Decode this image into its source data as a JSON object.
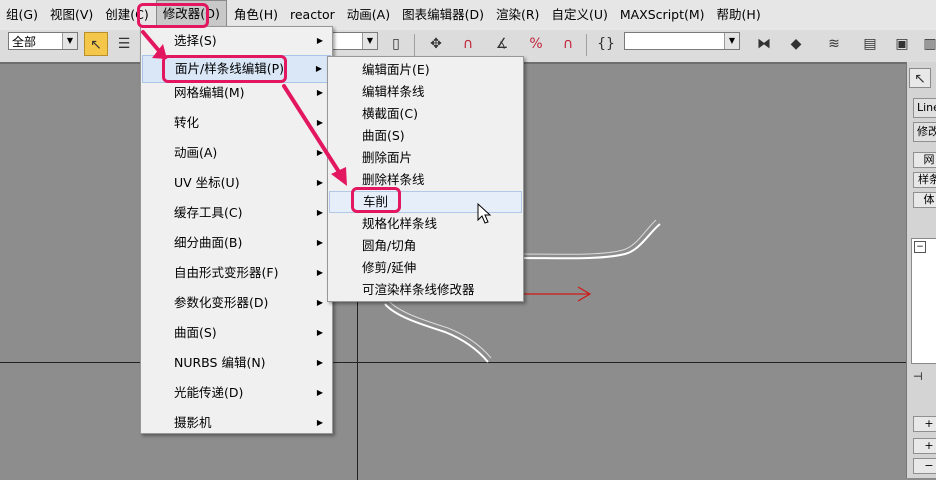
{
  "menubar": {
    "items": [
      "组(G)",
      "视图(V)",
      "创建(C)",
      "修改器(O)",
      "角色(H)",
      "reactor",
      "动画(A)",
      "图表编辑器(D)",
      "渲染(R)",
      "自定义(U)",
      "MAXScript(M)",
      "帮助(H)"
    ],
    "active_index": 3
  },
  "toolbar": {
    "selection_filter": "全部",
    "named_selection": ""
  },
  "modifiers_menu": {
    "items": [
      {
        "label": "选择(S)",
        "submenu": true
      },
      {
        "label": "面片/样条线编辑(P)",
        "submenu": true
      },
      {
        "label": "网格编辑(M)",
        "submenu": true
      },
      {
        "label": "转化",
        "submenu": true
      },
      {
        "label": "动画(A)",
        "submenu": true
      },
      {
        "label": "UV 坐标(U)",
        "submenu": true
      },
      {
        "label": "缓存工具(C)",
        "submenu": true
      },
      {
        "label": "细分曲面(B)",
        "submenu": true
      },
      {
        "label": "自由形式变形器(F)",
        "submenu": true
      },
      {
        "label": "参数化变形器(D)",
        "submenu": true
      },
      {
        "label": "曲面(S)",
        "submenu": true
      },
      {
        "label": "NURBS 编辑(N)",
        "submenu": true
      },
      {
        "label": "光能传递(D)",
        "submenu": true
      },
      {
        "label": "摄影机",
        "submenu": true
      }
    ],
    "highlighted_index": 1
  },
  "patch_spline_submenu": {
    "items": [
      "编辑面片(E)",
      "编辑样条线",
      "横截面(C)",
      "曲面(S)",
      "删除面片",
      "删除样条线",
      "车削",
      "规格化样条线",
      "圆角/切角",
      "修剪/延伸",
      "可渲染样条线修改器"
    ],
    "highlighted_index": 6
  },
  "command_panel": {
    "object_name": "Line",
    "modifier_list": "修改",
    "buttons": [
      "网",
      "样条",
      "体"
    ]
  },
  "colors": {
    "annotation": "#e3175f",
    "menu_bg": "#f0f0f0",
    "highlight": "#d9e7f7",
    "viewport": "#8d8d8d"
  }
}
